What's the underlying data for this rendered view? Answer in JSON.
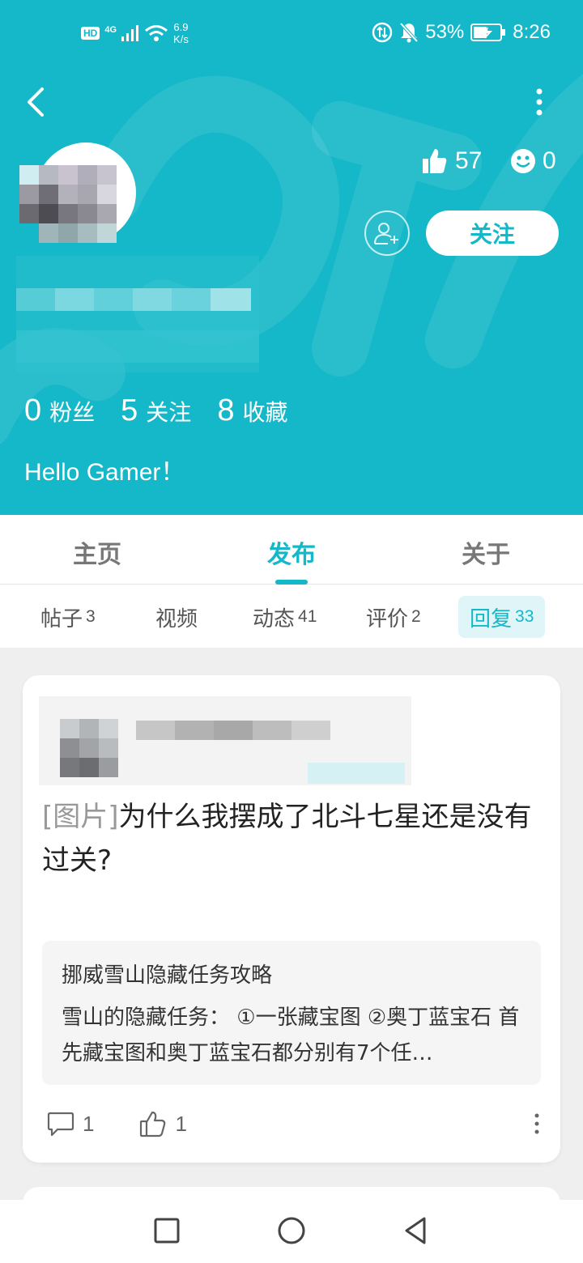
{
  "status_bar": {
    "hd": "HD",
    "network": "4G",
    "speed_value": "6.9",
    "speed_unit": "K/s",
    "battery": "53%",
    "time": "8:26"
  },
  "profile": {
    "likes": "57",
    "emoji_count": "0",
    "follow_label": "关注",
    "fans_count": "0",
    "fans_label": "粉丝",
    "following_count": "5",
    "following_label": "关注",
    "favorites_count": "8",
    "favorites_label": "收藏",
    "bio": "Hello Gamer！"
  },
  "main_tabs": {
    "home": "主页",
    "publish": "发布",
    "about": "关于"
  },
  "sub_tabs": [
    {
      "label": "帖子",
      "count": "3"
    },
    {
      "label": "视频",
      "count": ""
    },
    {
      "label": "动态",
      "count": "41"
    },
    {
      "label": "评价",
      "count": "2"
    },
    {
      "label": "回复",
      "count": "33"
    }
  ],
  "post": {
    "tag": "[图片]",
    "title": "为什么我摆成了北斗七星还是没有过关?",
    "quote_title": "挪威雪山隐藏任务攻略",
    "quote_body": "雪山的隐藏任务： ①一张藏宝图 ②奥丁蓝宝石 首先藏宝图和奥丁蓝宝石都分别有7个任…",
    "comments": "1",
    "likes": "1"
  },
  "colors": {
    "accent": "#15b8c8",
    "background": "#efefef"
  }
}
